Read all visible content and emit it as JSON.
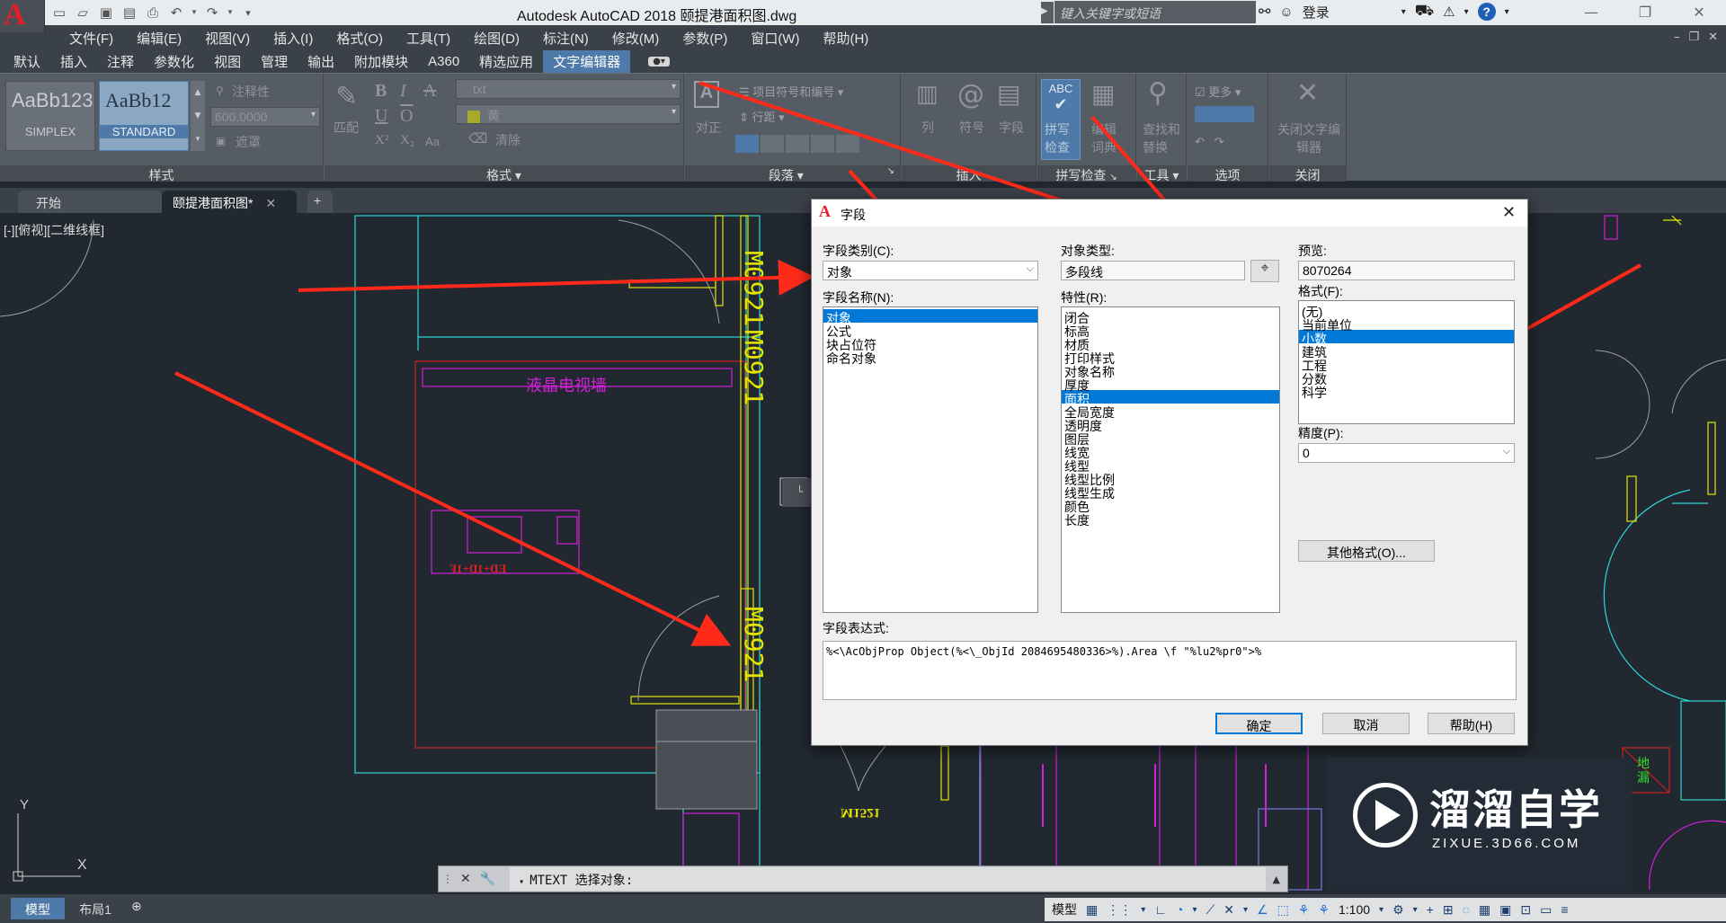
{
  "window": {
    "title": "Autodesk AutoCAD 2018    颐提港面积图.dwg",
    "app_logo": "A",
    "search_placeholder": "键入关键字或短语",
    "login_label": "登录",
    "help_icon": "?"
  },
  "menubar": {
    "items": [
      "文件(F)",
      "编辑(E)",
      "视图(V)",
      "插入(I)",
      "格式(O)",
      "工具(T)",
      "绘图(D)",
      "标注(N)",
      "修改(M)",
      "参数(P)",
      "窗口(W)",
      "帮助(H)"
    ]
  },
  "ribbon_tabs": {
    "items": [
      "默认",
      "插入",
      "注释",
      "参数化",
      "视图",
      "管理",
      "输出",
      "附加模块",
      "A360",
      "精选应用",
      "文字编辑器"
    ],
    "active": "文字编辑器"
  },
  "ribbon": {
    "style_panel": {
      "title": "样式",
      "style1_preview": "AaBb123",
      "style1_name": "SIMPLEX",
      "style2_preview": "AaBb12",
      "style2_name": "STANDARD",
      "annotative": "注释性",
      "height_value": "600.0000",
      "mask": "遮罩"
    },
    "format_panel": {
      "title": "格式",
      "match": "匹配",
      "bold": "B",
      "italic": "I",
      "strike": "A",
      "underline": "U",
      "overline": "O",
      "superscript": "X²",
      "subscript": "X₂",
      "case": "Aa",
      "font_value": "txt",
      "color_value": "黄",
      "clear": "清除"
    },
    "paragraph_panel": {
      "title": "段落",
      "justify": "对正",
      "bullets": "项目符号和编号",
      "line_spacing": "行距"
    },
    "insert_panel": {
      "title": "插入",
      "columns": "列",
      "symbol": "符号",
      "field": "字段"
    },
    "spell_panel": {
      "title": "拼写检查",
      "spell_check": "拼写检查",
      "edit_dict": "编辑词典"
    },
    "tools_panel": {
      "title": "工具",
      "find_replace": "查找和替换"
    },
    "options_panel": {
      "title": "选项",
      "more": "更多"
    },
    "close_panel": {
      "title": "关闭",
      "close_editor": "关闭文字编辑器"
    }
  },
  "doc_tabs": {
    "items": [
      "开始",
      "颐提港面积图*"
    ],
    "active": "颐提港面积图*"
  },
  "viewport_label": "[-][俯视][二维线框]",
  "drawing": {
    "labels": {
      "tv_wall": "液晶电视墙",
      "door1": "M0921",
      "door2": "M0921",
      "door3": "M0921",
      "window_code": "M1521",
      "mirror_text": "ED+1D+1F",
      "floor_drain": "地漏"
    }
  },
  "dialog": {
    "title": "字段",
    "field_category_label": "字段类别(C):",
    "field_category_value": "对象",
    "field_names_label": "字段名称(N):",
    "field_names": [
      "对象",
      "公式",
      "块占位符",
      "命名对象"
    ],
    "field_names_selected": 0,
    "object_type_label": "对象类型:",
    "object_type_value": "多段线",
    "properties_label": "特性(R):",
    "properties": [
      "闭合",
      "标高",
      "材质",
      "打印样式",
      "对象名称",
      "厚度",
      "面积",
      "全局宽度",
      "透明度",
      "图层",
      "线宽",
      "线型",
      "线型比例",
      "线型生成",
      "颜色",
      "长度"
    ],
    "properties_selected": 6,
    "preview_label": "预览:",
    "preview_value": "8070264",
    "format_label": "格式(F):",
    "formats": [
      "(无)",
      "当前单位",
      "小数",
      "建筑",
      "工程",
      "分数",
      "科学"
    ],
    "formats_selected": 2,
    "precision_label": "精度(P):",
    "precision_value": "0",
    "other_format_button": "其他格式(O)...",
    "expression_label": "字段表达式:",
    "expression": "%<\\AcObjProp Object(%<\\_ObjId 2084695480336>%).Area \\f \"%lu2%pr0\">%",
    "ok": "确定",
    "cancel": "取消",
    "help": "帮助(H)"
  },
  "command_line": {
    "prompt": "MTEXT 选择对象:"
  },
  "status_bar": {
    "model_tab": "模型",
    "layout_tab": "布局1",
    "model_label": "模型",
    "scale": "1:100"
  },
  "watermark": {
    "brand": "溜溜自学",
    "url": "ZIXUE.3D66.COM"
  },
  "ucs": {
    "x": "X",
    "y": "Y"
  },
  "colors": {
    "arrow": "#ff2a1a",
    "selection": "#0078d7",
    "cad_background": "#212830",
    "cyan": "#2fd4d4",
    "magenta": "#d020d8",
    "yellow": "#e4e400"
  }
}
